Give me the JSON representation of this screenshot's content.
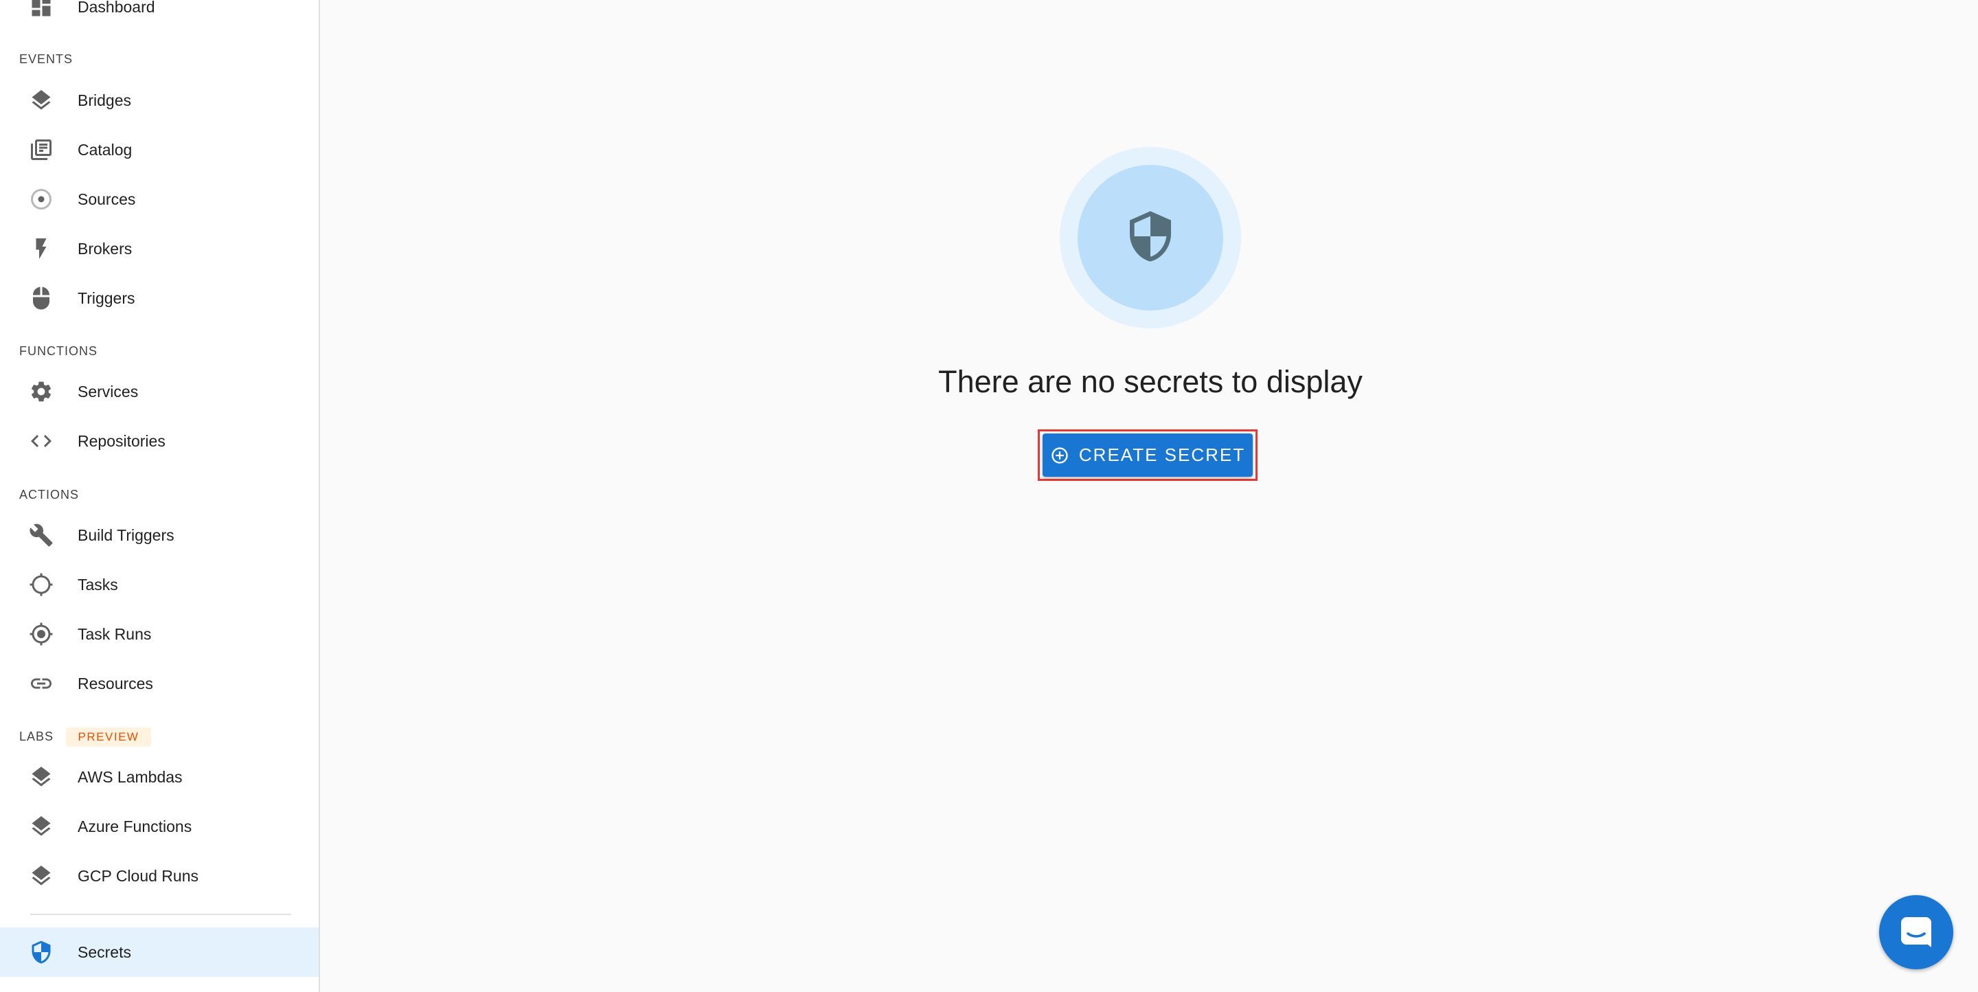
{
  "sidebar": {
    "top_item": {
      "label": "Dashboard",
      "icon": "dashboard-icon"
    },
    "sections": {
      "events": "EVENTS",
      "functions": "FUNCTIONS",
      "actions": "ACTIONS",
      "labs": "LABS",
      "labs_badge": "PREVIEW"
    },
    "items": {
      "bridges": {
        "label": "Bridges",
        "icon": "layers-icon"
      },
      "catalog": {
        "label": "Catalog",
        "icon": "library-books-icon"
      },
      "sources": {
        "label": "Sources",
        "icon": "sources-target-icon"
      },
      "brokers": {
        "label": "Brokers",
        "icon": "flash-icon"
      },
      "triggers": {
        "label": "Triggers",
        "icon": "mouse-icon"
      },
      "services": {
        "label": "Services",
        "icon": "gear-icon"
      },
      "repositories": {
        "label": "Repositories",
        "icon": "code-icon"
      },
      "build_triggers": {
        "label": "Build Triggers",
        "icon": "wrench-icon"
      },
      "tasks": {
        "label": "Tasks",
        "icon": "crosshair-icon"
      },
      "task_runs": {
        "label": "Task Runs",
        "icon": "gps-fixed-icon"
      },
      "resources": {
        "label": "Resources",
        "icon": "link-icon"
      },
      "aws_lambdas": {
        "label": "AWS Lambdas",
        "icon": "layers-icon"
      },
      "azure_functions": {
        "label": "Azure Functions",
        "icon": "layers-icon"
      },
      "gcp_cloud_runs": {
        "label": "GCP Cloud Runs",
        "icon": "layers-icon"
      },
      "secrets": {
        "label": "Secrets",
        "icon": "shield-icon",
        "active": true
      }
    }
  },
  "main": {
    "empty_state": {
      "icon": "shield-icon",
      "title": "There are no secrets to display",
      "button_label": "CREATE SECRET",
      "button_icon": "add-circle-icon"
    }
  },
  "chat_widget": {
    "icon": "chat-icon"
  },
  "colors": {
    "accent": "#1976d2",
    "active_bg": "#e3f2fd",
    "highlight": "#e53935",
    "badge_bg": "#fff3e0",
    "badge_text": "#e65100"
  }
}
